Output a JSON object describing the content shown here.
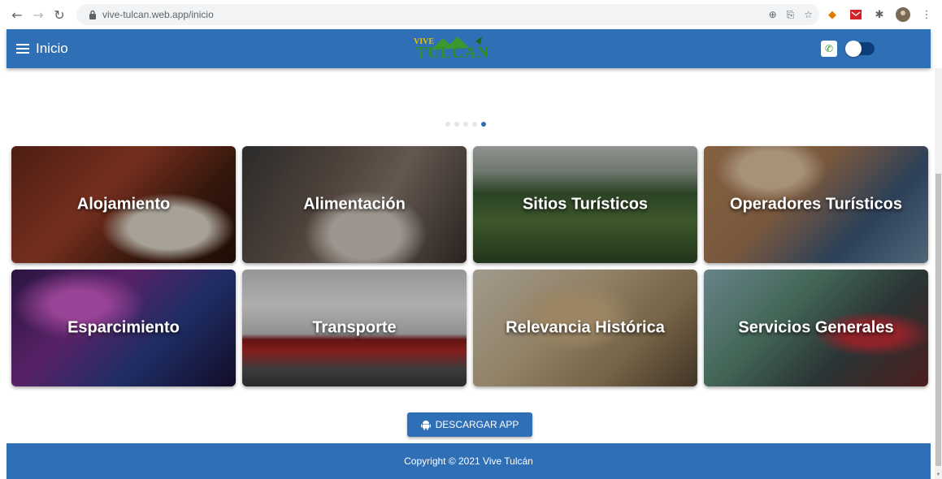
{
  "browser": {
    "url": "vive-tulcan.web.app/inicio",
    "icons": [
      "back-arrow-icon",
      "forward-arrow-icon",
      "reload-icon",
      "lock-icon",
      "translate-icon",
      "bookmark-star-icon",
      "extensions-icon",
      "menu-kebab-icon"
    ]
  },
  "appbar": {
    "title": "Inicio",
    "logo_small": "VIVE",
    "logo_main": "TULCAN",
    "color": "#2f6fb6"
  },
  "carousel": {
    "dot_count": 5,
    "active_index": 4
  },
  "categories": [
    {
      "label": "Alojamiento"
    },
    {
      "label": "Alimentación"
    },
    {
      "label": "Sitios Turísticos"
    },
    {
      "label": "Operadores Turísticos"
    },
    {
      "label": "Esparcimiento"
    },
    {
      "label": "Transporte"
    },
    {
      "label": "Relevancia Histórica"
    },
    {
      "label": "Servicios Generales"
    }
  ],
  "download_button": {
    "label": "DESCARGAR APP",
    "icon": "android-icon"
  },
  "footer": {
    "copyright": "Copyright © 2021 Vive Tulcán"
  }
}
